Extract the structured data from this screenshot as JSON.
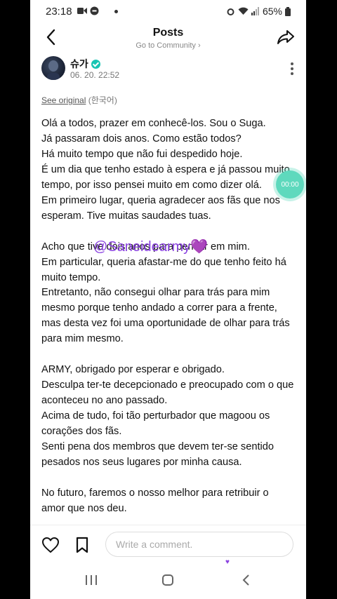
{
  "status_bar": {
    "time": "23:18",
    "battery": "65%"
  },
  "header": {
    "title": "Posts",
    "subtitle": "Go to Community ›"
  },
  "post": {
    "author": "슈가",
    "timestamp": "06. 20. 22:52",
    "see_original_link": "See original",
    "see_original_lang": "(한국어)",
    "paragraphs": [
      "Olá a todos, prazer em conhecê-los. Sou o Suga.\nJá passaram dois anos. Como estão todos?\nHá muito tempo que não fui despedido hoje.\nÉ um dia que tenho estado à espera e já passou muito tempo, por isso pensei muito em como dizer olá.\nEm primeiro lugar, queria agradecer aos fãs que nos esperam. Tive muitas saudades tuas.",
      " ",
      "Acho que tive dois anos para pensar em mim.\nEm particular, queria afastar-me do que tenho feito há muito tempo.\nEntretanto, não consegui olhar para trás para mim mesmo porque tenho andado a correr para a frente, mas desta vez foi uma oportunidade de olhar para trás para mim mesmo.",
      " ",
      "ARMY, obrigado por esperar e obrigado.\nDesculpa ter-te decepcionado e preocupado com o que aconteceu no ano passado.\nAcima de tudo, foi tão perturbador que magoou os corações dos fãs.\nSenti pena dos membros que devem ter-se sentido pesados nos seus lugares por minha causa.",
      " ",
      "No futuro, faremos o nosso melhor para retribuir o amor que nos deu."
    ]
  },
  "overlay": {
    "watermark": "@Saneidearmy💜",
    "timer": "00:00"
  },
  "bottom_bar": {
    "comment_placeholder": "Write a comment."
  },
  "icons": {
    "back": "back-arrow-icon",
    "share": "share-icon",
    "more": "more-vertical-icon",
    "like": "heart-icon",
    "bookmark": "bookmark-icon",
    "nav_recent": "recent-apps-icon",
    "nav_home": "home-icon",
    "nav_back": "nav-back-icon"
  },
  "colors": {
    "accent_verified": "#18c5b3",
    "watermark": "#8a42e0"
  }
}
